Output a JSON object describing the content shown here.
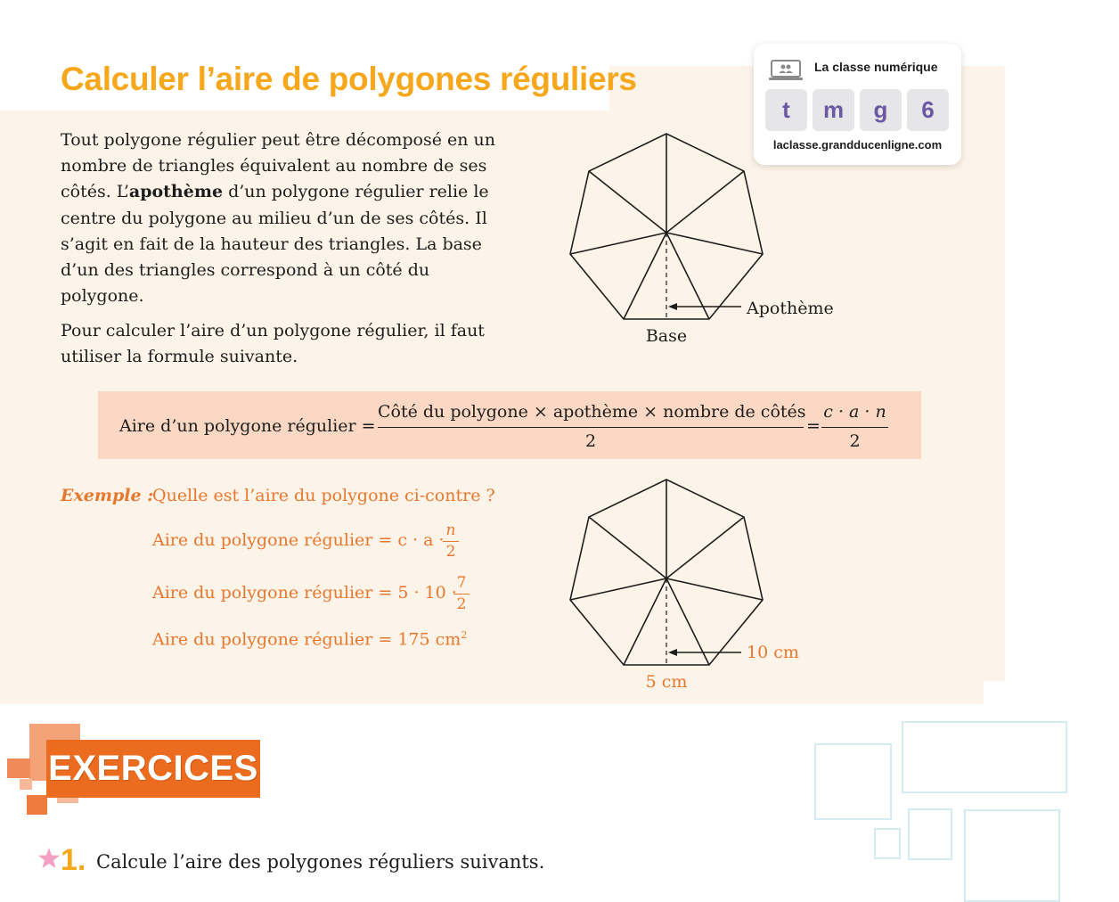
{
  "title": "Calculer l’aire de polygones réguliers",
  "classroom_card": {
    "title": "La classe numérique",
    "code": [
      "t",
      "m",
      "g",
      "6"
    ],
    "url": "laclasse.grandducenligne.com"
  },
  "intro": {
    "part1": "Tout polygone régulier peut être décomposé en un nombre de triangles équivalent au nombre de ses côtés. L’",
    "apothem_term": "apothème",
    "part2": " d’un polygone régulier relie le centre du polygone au milieu d’un de ses côtés. Il s’agit en fait de la hauteur des triangles. La base d’un des triangles correspond à un côté du polygone.",
    "paragraph2": "Pour calculer l’aire d’un polygone régulier, il faut utiliser la formule suivante."
  },
  "diagram1": {
    "apothem_label": "Apothème",
    "base_label": "Base"
  },
  "formula": {
    "lhs": "Aire d’un polygone régulier =",
    "numerator": "Côté du polygone × apothème × nombre de côtés",
    "denominator": "2",
    "equals": "=",
    "short_numerator": "c · a · n",
    "short_denominator": "2"
  },
  "example": {
    "label": "Exemple :",
    "question": "Quelle est l’aire du polygone ci-contre ?",
    "line1_prefix": "Aire du polygone régulier = c · a ·",
    "line1_num": "n",
    "line1_den": "2",
    "line2_prefix": "Aire du polygone régulier = 5 · 10 ·",
    "line2_num": "7",
    "line2_den": "2",
    "line3_prefix": "Aire du polygone régulier = 175 cm",
    "line3_sup": "2"
  },
  "diagram2": {
    "apothem_label": "10 cm",
    "base_label": "5 cm"
  },
  "exercises": {
    "banner": "EXERCICES",
    "items": [
      {
        "number": "1.",
        "text": "Calcule l’aire des polygones réguliers suivants."
      }
    ]
  },
  "colors": {
    "title": "#f6a71c",
    "panel": "#fdf4e9",
    "formula_box": "#fbd8c4",
    "example": "#e8772e",
    "banner": "#ec6c1f",
    "code_letters": "#6b58a3"
  }
}
